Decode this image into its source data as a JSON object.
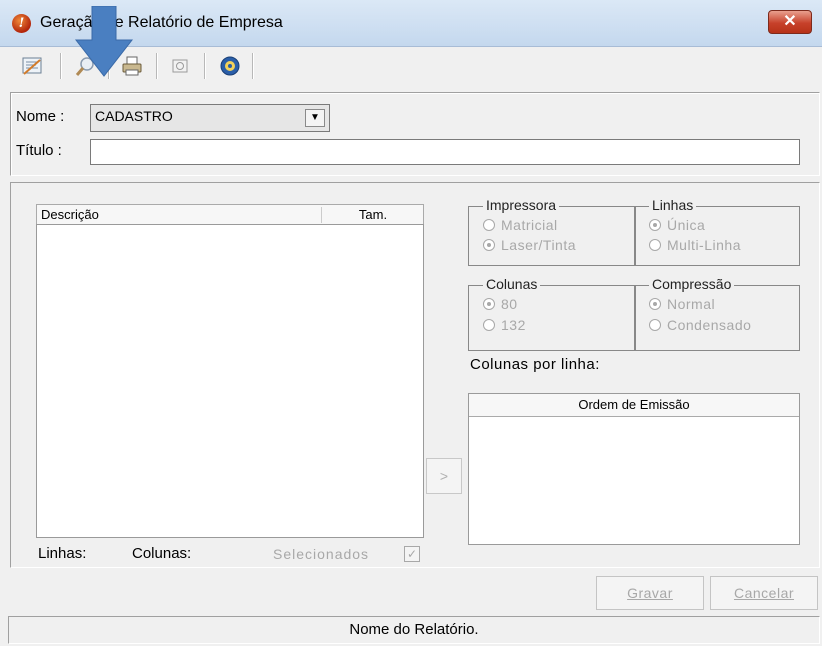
{
  "window": {
    "title": "Geração de Relatório de Empresa",
    "close_label": "✕"
  },
  "toolbar": {
    "buttons": [
      "report-icon",
      "search-icon",
      "print-icon",
      "preview-icon",
      "help-icon"
    ]
  },
  "form": {
    "nome_label": "Nome :",
    "nome_value": "CADASTRO",
    "titulo_label": "Título :",
    "titulo_value": ""
  },
  "list": {
    "col_descricao": "Descrição",
    "col_tam": "Tam.",
    "linhas_label": "Linhas:",
    "colunas_label": "Colunas:",
    "selecionados_label": "Selecionados",
    "selecionados_checked": true,
    "move_button": ">"
  },
  "options": {
    "impressora": {
      "title": "Impressora",
      "items": [
        "Matricial",
        "Laser/Tinta"
      ],
      "selected": "Laser/Tinta"
    },
    "linhas": {
      "title": "Linhas",
      "items": [
        "Única",
        "Multi-Linha"
      ],
      "selected": "Única"
    },
    "colunas": {
      "title": "Colunas",
      "items": [
        "80",
        "132"
      ],
      "selected": "80"
    },
    "compressao": {
      "title": "Compressão",
      "items": [
        "Normal",
        "Condensado"
      ],
      "selected": "Normal"
    },
    "colunas_por_linha_label": "Colunas por linha:"
  },
  "ordem": {
    "header": "Ordem de Emissão"
  },
  "buttons": {
    "gravar": "Gravar",
    "cancelar": "Cancelar"
  },
  "status": {
    "text": "Nome do Relatório."
  },
  "colors": {
    "arrow": "#4a7fc1",
    "disabled_text": "#a8a8a8"
  }
}
